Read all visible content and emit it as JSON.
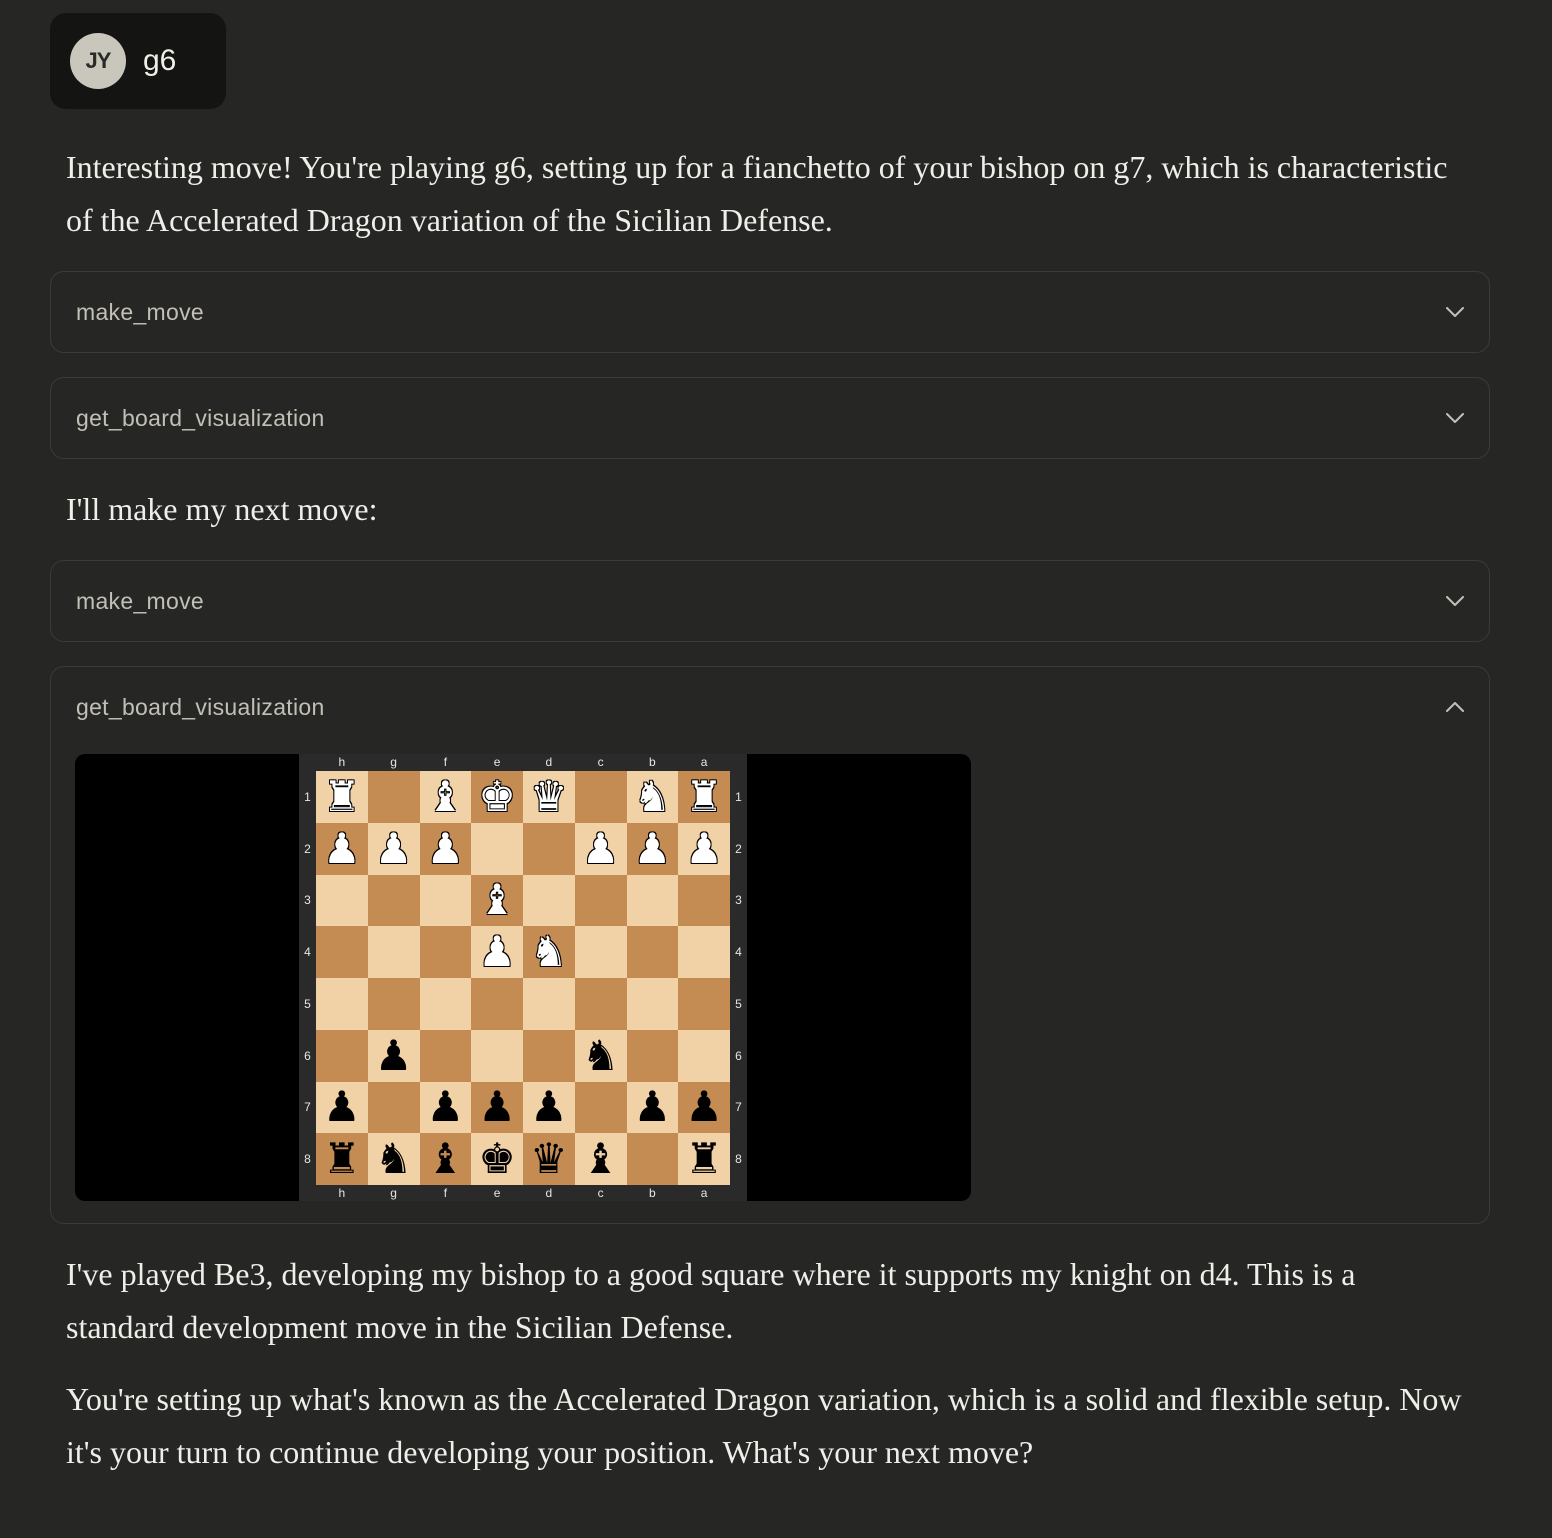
{
  "user": {
    "initials": "JY",
    "message": "g6"
  },
  "assistant": {
    "intro": "Interesting move! You're playing g6, setting up for a fianchetto of your bishop on g7, which is characteristic of the Accelerated Dragon variation of the Sicilian Defense.",
    "next_move": "I'll make my next move:",
    "after_1": "I've played Be3, developing my bishop to a good square where it supports my knight on d4. This is a standard development move in the Sicilian Defense.",
    "after_2": "You're setting up what's known as the Accelerated Dragon variation, which is a solid and flexible setup. Now it's your turn to continue developing your position. What's your next move?"
  },
  "tools": [
    {
      "name": "make_move",
      "expanded": false
    },
    {
      "name": "get_board_visualization",
      "expanded": false
    },
    {
      "name": "make_move",
      "expanded": false
    },
    {
      "name": "get_board_visualization",
      "expanded": true
    }
  ],
  "board": {
    "files": [
      "h",
      "g",
      "f",
      "e",
      "d",
      "c",
      "b",
      "a"
    ],
    "ranks": [
      "1",
      "2",
      "3",
      "4",
      "5",
      "6",
      "7",
      "8"
    ],
    "rows": [
      [
        "wR",
        "",
        "wB",
        "wK",
        "wQ",
        "",
        "wN",
        "wR"
      ],
      [
        "wP",
        "wP",
        "wP",
        "",
        "",
        "wP",
        "wP",
        "wP"
      ],
      [
        "",
        "",
        "",
        "wB",
        "",
        "",
        "",
        ""
      ],
      [
        "",
        "",
        "",
        "wP",
        "wN",
        "",
        "",
        ""
      ],
      [
        "",
        "",
        "",
        "",
        "",
        "",
        "",
        ""
      ],
      [
        "",
        "bP",
        "",
        "",
        "",
        "bN",
        "",
        ""
      ],
      [
        "bP",
        "",
        "bP",
        "bP",
        "bP",
        "",
        "bP",
        "bP"
      ],
      [
        "bR",
        "bN",
        "bB",
        "bK",
        "bQ",
        "bB",
        "",
        "bR"
      ]
    ],
    "light_color": "#f1d1a6",
    "dark_color": "#c48c53"
  }
}
